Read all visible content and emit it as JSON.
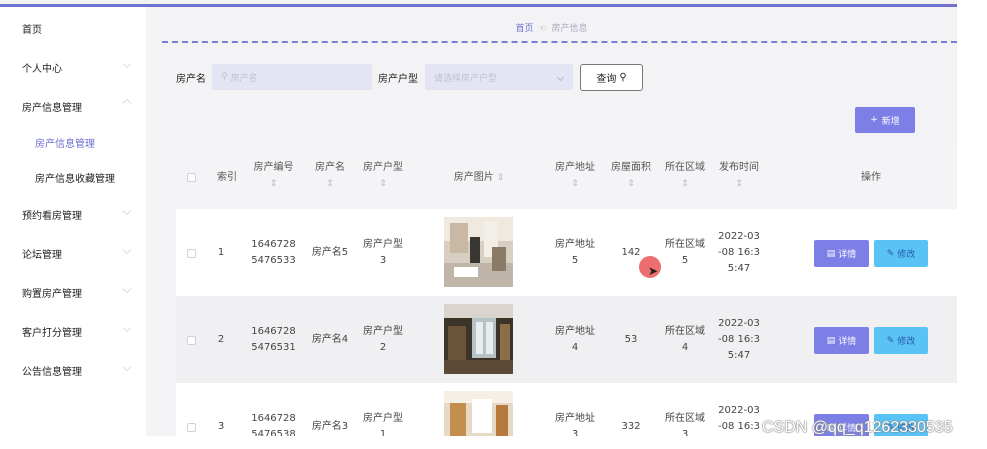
{
  "sidebar": {
    "items": [
      {
        "label": "首页"
      },
      {
        "label": "个人中心"
      },
      {
        "label": "房产信息管理"
      },
      {
        "label": "房产信息管理"
      },
      {
        "label": "房产信息收藏管理"
      },
      {
        "label": "预约看房管理"
      },
      {
        "label": "论坛管理"
      },
      {
        "label": "购置房产管理"
      },
      {
        "label": "客户打分管理"
      },
      {
        "label": "公告信息管理"
      }
    ]
  },
  "breadcrumb": {
    "home": "首页",
    "current": "房产信息"
  },
  "search": {
    "name_label": "房产名",
    "name_placeholder": "房产名",
    "type_label": "房产户型",
    "type_placeholder": "请选择房产户型",
    "button_label": "查询"
  },
  "toolbar": {
    "add_label": "新增"
  },
  "table": {
    "headers": [
      "索引",
      "房产编号",
      "房产名",
      "房产户型",
      "房产图片",
      "房产地址",
      "房屋面积",
      "所在区域",
      "发布时间",
      "操作"
    ],
    "rows": [
      {
        "index": "1",
        "code": "1646728\n5476533",
        "name": "房产名5",
        "type": "房产户型\n3",
        "address": "房产地址\n5",
        "area": "142",
        "region": "所在区域\n5",
        "time": "2022-03\n-08 16:3\n5:47"
      },
      {
        "index": "2",
        "code": "1646728\n5476531",
        "name": "房产名4",
        "type": "房产户型\n2",
        "address": "房产地址\n4",
        "area": "53",
        "region": "所在区域\n4",
        "time": "2022-03\n-08 16:3\n5:47"
      },
      {
        "index": "3",
        "code": "1646728\n5476538",
        "name": "房产名3",
        "type": "房产户型\n1",
        "address": "房产地址\n3",
        "area": "332",
        "region": "所在区域\n3",
        "time": "2022-03\n-08 16:3"
      }
    ],
    "detail_label": "详情",
    "edit_label": "修改"
  },
  "watermark": "CSDN @qq_q1262330535",
  "colors": {
    "accent": "#7c7fe6",
    "edit": "#59c3f6",
    "active": "#6f6fcf"
  },
  "icons": {
    "search": "search-icon",
    "plus": "plus-icon",
    "detail": "document-icon",
    "edit": "pencil-icon",
    "crumb": "hand-icon"
  }
}
